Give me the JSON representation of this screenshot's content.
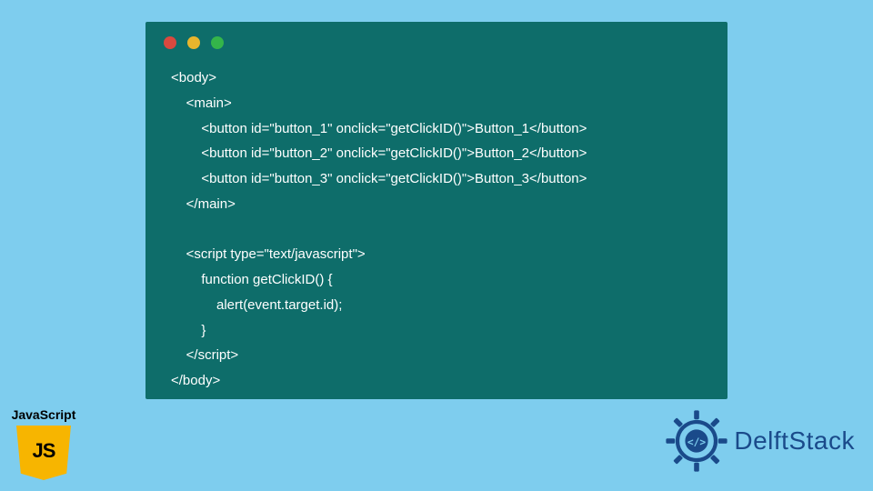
{
  "code_lines": [
    "<body>",
    "    <main>",
    "        <button id=\"button_1\" onclick=\"getClickID()\">Button_1</button>",
    "        <button id=\"button_2\" onclick=\"getClickID()\">Button_2</button>",
    "        <button id=\"button_3\" onclick=\"getClickID()\">Button_3</button>",
    "    </main>",
    "",
    "    <script type=\"text/javascript\">",
    "        function getClickID() {",
    "            alert(event.target.id);",
    "        }",
    "    </script>",
    "</body>"
  ],
  "js_badge": {
    "label": "JavaScript",
    "logo_text": "JS"
  },
  "brand": {
    "text": "DelftStack"
  },
  "window": {
    "dot_colors": [
      "#d9493f",
      "#e8b52d",
      "#34b54a"
    ]
  }
}
